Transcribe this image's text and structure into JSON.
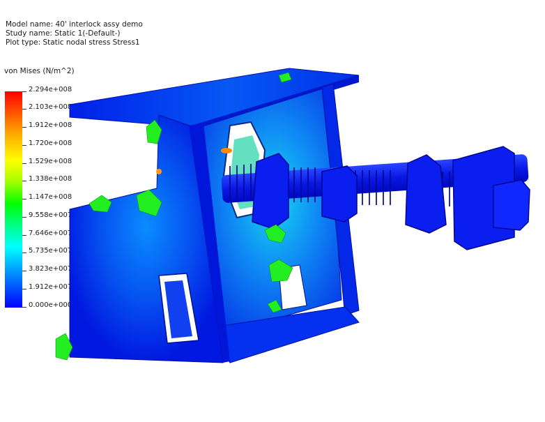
{
  "header": {
    "model_name": "Model name: 40' interlock assy demo",
    "study_name": "Study name: Static 1(-Default-)",
    "plot_type": "Plot type: Static nodal stress Stress1"
  },
  "legend": {
    "title": "von Mises (N/m^2)",
    "ticks": [
      "2.294e+008",
      "2.103e+008",
      "1.912e+008",
      "1.720e+008",
      "1.529e+008",
      "1.338e+008",
      "1.147e+008",
      "9.558e+007",
      "7.646e+007",
      "5.735e+007",
      "3.823e+007",
      "1.912e+007",
      "0.000e+000"
    ],
    "colors": [
      "#ff0000",
      "#ff6600",
      "#ffaa00",
      "#ffff00",
      "#a0ff00",
      "#00ff00",
      "#00ffa0",
      "#00ffff",
      "#0090ff",
      "#0000ff"
    ]
  },
  "viewport": {
    "model_icon": "fea-stress-model"
  }
}
